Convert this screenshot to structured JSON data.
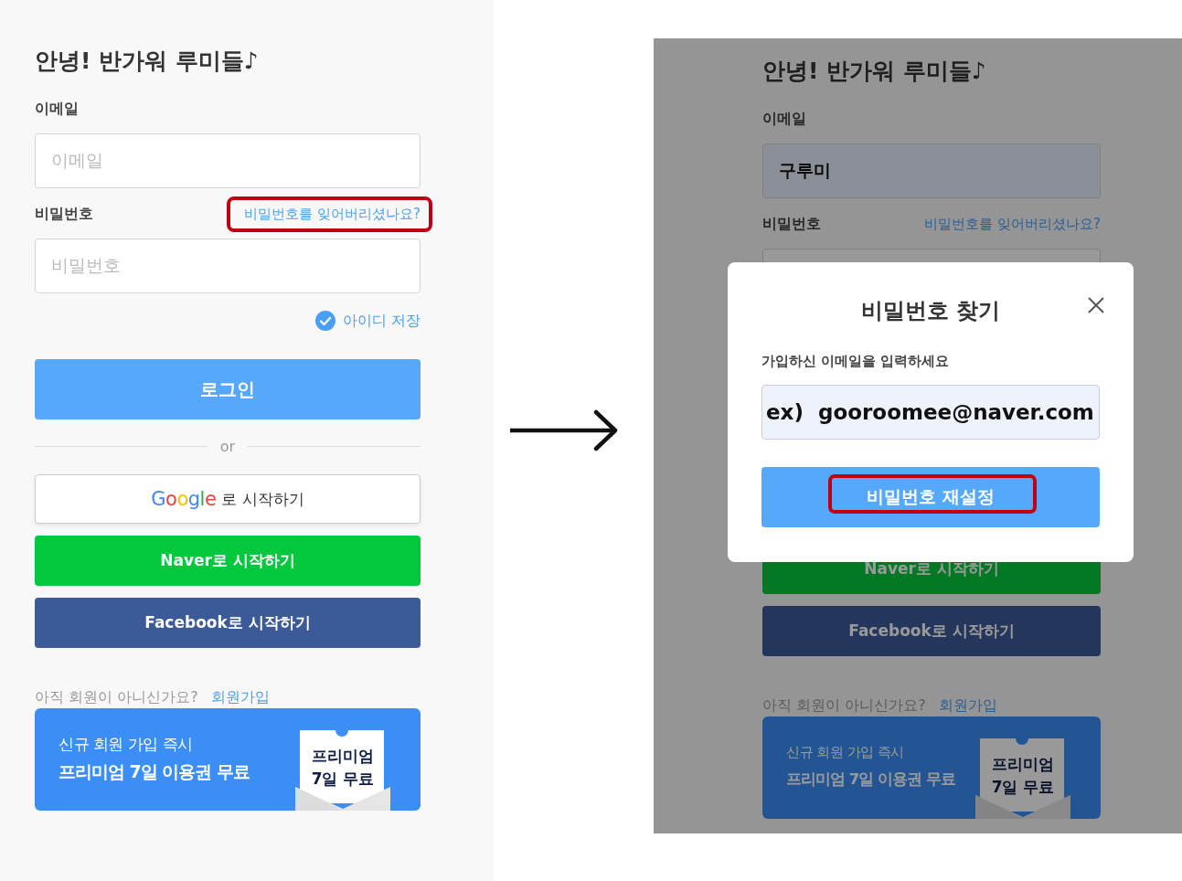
{
  "login_screen": {
    "title": "안녕! 반가워 루미들♪",
    "email_label": "이메일",
    "email_field": {
      "placeholder": "이메일"
    },
    "password_label": "비밀번호",
    "forgot_link": {
      "text": "비밀번호를 잊어버리셨나요?",
      "highlighted": true
    },
    "password_field": {
      "placeholder": "비밀번호"
    },
    "remember_id": {
      "label": "아이디 저장",
      "checked": true
    },
    "login_button": "로그인",
    "divider_text": "or",
    "social_buttons": [
      {
        "kind": "google",
        "logo": "Google",
        "label": "로 시작하기"
      },
      {
        "kind": "naver",
        "label": "Naver로 시작하기"
      },
      {
        "kind": "facebook",
        "label": "Facebook로 시작하기"
      }
    ],
    "signup": {
      "prompt": "아직 회원이 아니신가요?",
      "link": "회원가입"
    },
    "banner": {
      "line_1": "신규 회원 가입 즉시",
      "line_2": "프리미엄 7일 이용권 무료",
      "ticket_lines": [
        "프리미엄",
        "7일 무료"
      ]
    }
  },
  "dimmed_screen": {
    "title": "안녕! 반가워 루미들♪",
    "email_label": "이메일",
    "email_field": {
      "value": "구루미"
    },
    "password_label": "비밀번호",
    "forgot_link": {
      "text": "비밀번호를 잊어버리셨나요?",
      "highlighted": false
    },
    "social_buttons": [
      {
        "kind": "naver",
        "label": "Naver로 시작하기"
      },
      {
        "kind": "facebook",
        "label": "Facebook로 시작하기"
      }
    ],
    "signup": {
      "prompt": "아직 회원이 아니신가요?",
      "link": "회원가입"
    },
    "banner": {
      "line_1": "신규 회원 가입 즉시",
      "line_2": "프리미엄 7일 이용권 무료",
      "ticket_lines": [
        "프리미엄",
        "7일 무료"
      ]
    }
  },
  "reset_modal": {
    "title": "비밀번호 찾기",
    "prompt": "가입하신 이메일을 입력하세요",
    "email_field": {
      "value": "ex)  gooroomee@naver.com"
    },
    "reset_button": {
      "label": "비밀번호 재설정",
      "highlighted": true
    }
  }
}
